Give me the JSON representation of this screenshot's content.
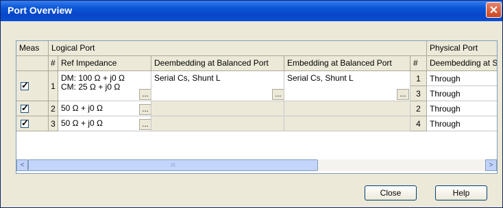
{
  "window": {
    "title": "Port Overview",
    "close_glyph": "✕"
  },
  "table": {
    "groups": {
      "meas": "Meas",
      "logical": "Logical Port",
      "physical": "Physical Port"
    },
    "columns": {
      "num": "#",
      "ref_impedance": "Ref Impedance",
      "deembedding_balanced": "Deembedding at Balanced Port",
      "embedding_balanced": "Embedding at Balanced Port",
      "phys_num": "#",
      "phys_deembedding": "Deembedding at S"
    },
    "rows": [
      {
        "num": "1",
        "checked": true,
        "ref_impedance_line1": "DM: 100 Ω + j0 Ω",
        "ref_impedance_line2": "CM: 25 Ω + j0 Ω",
        "deembedding": "Serial Cs, Shunt L",
        "embedding": "Serial Cs, Shunt L",
        "physical": [
          {
            "num": "1",
            "value": "Through"
          },
          {
            "num": "3",
            "value": "Through"
          }
        ]
      },
      {
        "num": "2",
        "checked": true,
        "ref_impedance": "50 Ω + j0 Ω",
        "deembedding": "",
        "embedding": "",
        "physical": [
          {
            "num": "2",
            "value": "Through"
          }
        ]
      },
      {
        "num": "3",
        "checked": true,
        "ref_impedance": "50 Ω + j0 Ω",
        "deembedding": "",
        "embedding": "",
        "physical": [
          {
            "num": "4",
            "value": "Through"
          }
        ]
      }
    ],
    "ellipsis": "...",
    "scroll": {
      "left": "<",
      "right": ">",
      "grip": "III"
    }
  },
  "buttons": {
    "close": "Close",
    "help": "Help"
  }
}
